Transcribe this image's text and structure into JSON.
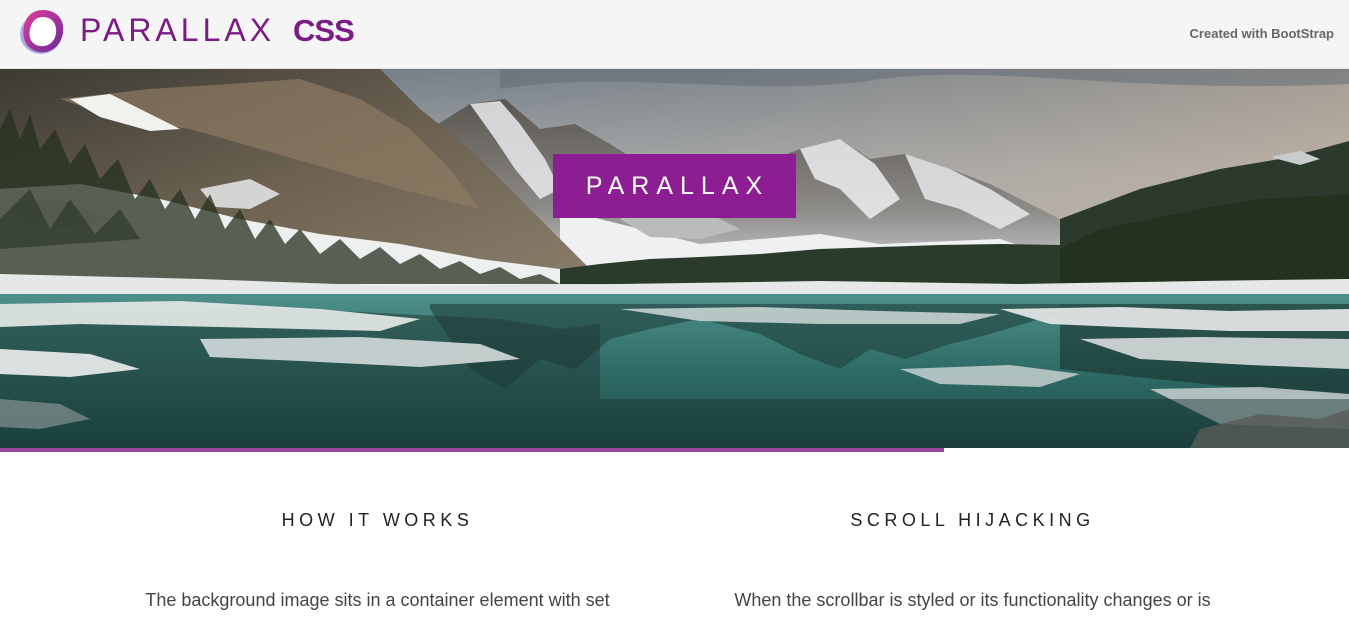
{
  "header": {
    "brand_main": "PARALLAX",
    "brand_sub": "CSS",
    "created_link": "Created with BootStrap",
    "logo_icon": "parallax-logo-icon"
  },
  "hero": {
    "badge_label": "PARALLAX",
    "scroll_progress_percent": 70,
    "image_subject": "mountain-lake-reflection"
  },
  "sections": [
    {
      "heading": "HOW IT WORKS",
      "text": "The background image sits in a container element with set"
    },
    {
      "heading": "SCROLL HIJACKING",
      "text": "When the scrollbar is styled or its functionality changes or is"
    }
  ],
  "colors": {
    "brand": "#7b1c86",
    "badge": "#8c1d92",
    "progress": "#97479c",
    "header_bg": "#f5f5f5"
  }
}
